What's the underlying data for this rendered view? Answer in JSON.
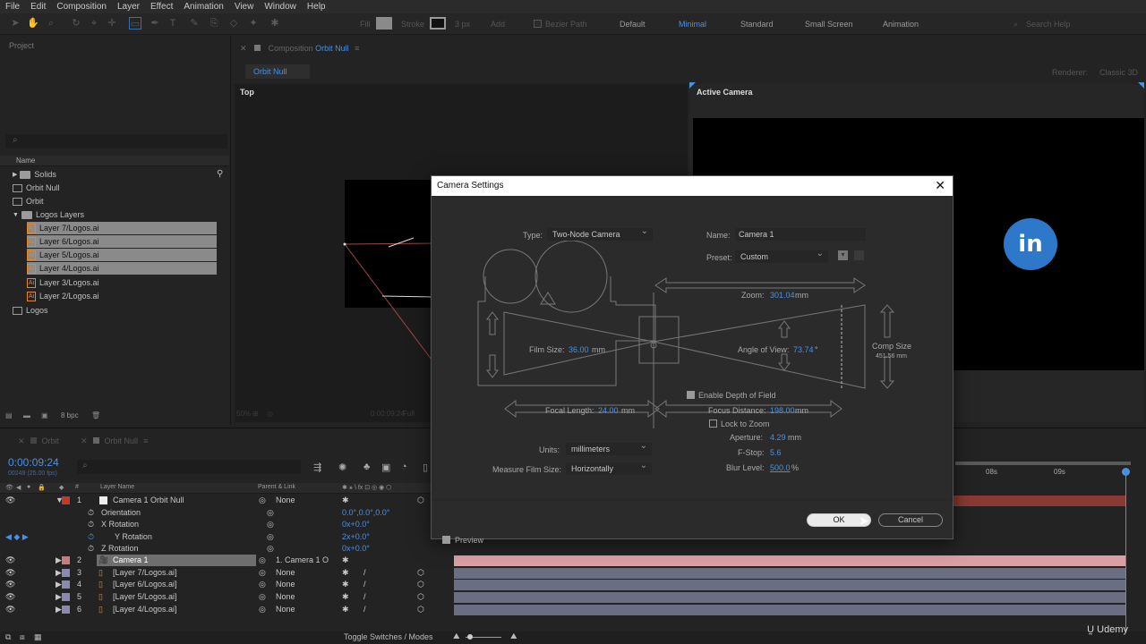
{
  "menu": [
    "File",
    "Edit",
    "Composition",
    "Layer",
    "Effect",
    "Animation",
    "View",
    "Window",
    "Help"
  ],
  "toolbar": {
    "fill": "Fill",
    "stroke": "Stroke",
    "stroke_px": "3 px",
    "add": "Add",
    "bezier": "Bezier Path",
    "workspaces": [
      "Default",
      "Minimal",
      "Standard",
      "Small Screen",
      "Animation"
    ],
    "active_workspace": "Minimal",
    "search_help": "Search Help"
  },
  "project": {
    "title": "Project",
    "col_name": "Name",
    "items": [
      {
        "label": "Solids",
        "type": "folder"
      },
      {
        "label": "Orbit Null",
        "type": "solid"
      },
      {
        "label": "Orbit",
        "type": "solid"
      },
      {
        "label": "Logos Layers",
        "type": "folder"
      },
      {
        "label": "Layer 7/Logos.ai",
        "type": "ai",
        "selected": true
      },
      {
        "label": "Layer 6/Logos.ai",
        "type": "ai",
        "selected": true
      },
      {
        "label": "Layer 5/Logos.ai",
        "type": "ai",
        "selected": true
      },
      {
        "label": "Layer 4/Logos.ai",
        "type": "ai",
        "selected": true
      },
      {
        "label": "Layer 3/Logos.ai",
        "type": "ai",
        "selected": false
      },
      {
        "label": "Layer 2/Logos.ai",
        "type": "ai",
        "selected": false
      },
      {
        "label": "Logos",
        "type": "solid"
      }
    ],
    "bpc": "8 bpc"
  },
  "comp": {
    "panel_title": "Composition",
    "comp_name": "Orbit Null",
    "tab": "Orbit Null",
    "renderer": "Renderer:",
    "renderer_value": "Classic 3D",
    "view_top": "Top",
    "view_active": "Active Camera",
    "zoom": "50%",
    "timecode": "0:00:09:24",
    "quality": "Full"
  },
  "timeline": {
    "tabs": [
      "Orbit",
      "Orbit Null"
    ],
    "timecode": "0:00:09:24",
    "fps": "00249 (25.00 fps)",
    "search_placeholder": "",
    "col_layer_name": "Layer Name",
    "col_parent": "Parent & Link",
    "ruler": [
      "08s",
      "09s"
    ],
    "rows": [
      {
        "num": "1",
        "name": "Camera 1 Orbit Null",
        "parent": "None",
        "kind": "layer",
        "color": "#c0392b"
      },
      {
        "num": "",
        "name": "Orientation",
        "value": "0.0°,0.0°,0.0°",
        "kind": "prop"
      },
      {
        "num": "",
        "name": "X Rotation",
        "value": "0x+0.0°",
        "kind": "prop"
      },
      {
        "num": "",
        "name": "Y Rotation",
        "value": "2x+0.0°",
        "kind": "prop"
      },
      {
        "num": "",
        "name": "Z Rotation",
        "value": "0x+0.0°",
        "kind": "prop"
      },
      {
        "num": "2",
        "name": "Camera 1",
        "parent": "1. Camera 1 O",
        "kind": "layer",
        "selected": true,
        "color": "#c08080"
      },
      {
        "num": "3",
        "name": "[Layer 7/Logos.ai]",
        "parent": "None",
        "kind": "layer",
        "color": "#8a8ab0"
      },
      {
        "num": "4",
        "name": "[Layer 6/Logos.ai]",
        "parent": "None",
        "kind": "layer",
        "color": "#8a8ab0"
      },
      {
        "num": "5",
        "name": "[Layer 5/Logos.ai]",
        "parent": "None",
        "kind": "layer",
        "color": "#8a8ab0"
      },
      {
        "num": "6",
        "name": "[Layer 4/Logos.ai]",
        "parent": "None",
        "kind": "layer",
        "color": "#8a8ab0"
      }
    ],
    "toggle_label": "Toggle Switches / Modes"
  },
  "dialog": {
    "title": "Camera Settings",
    "type_label": "Type:",
    "type_value": "Two-Node Camera",
    "name_label": "Name:",
    "name_value": "Camera 1",
    "preset_label": "Preset:",
    "preset_value": "Custom",
    "zoom_label": "Zoom:",
    "zoom_value": "301.04",
    "zoom_unit": "mm",
    "film_size_label": "Film Size:",
    "film_size_value": "36.00",
    "film_size_unit": "mm",
    "aov_label": "Angle of View:",
    "aov_value": "73.74",
    "aov_unit": "°",
    "comp_size_label": "Comp Size",
    "comp_size_value": "451.56 mm",
    "dof_label": "Enable Depth of Field",
    "dof_checked": true,
    "focal_length_label": "Focal Length:",
    "focal_length_value": "24.00",
    "focal_length_unit": "mm",
    "focus_distance_label": "Focus Distance:",
    "focus_distance_value": "198.00",
    "focus_distance_unit": "mm",
    "lock_zoom_label": "Lock to Zoom",
    "lock_zoom_checked": false,
    "aperture_label": "Aperture:",
    "aperture_value": "4.29",
    "aperture_unit": "mm",
    "fstop_label": "F-Stop:",
    "fstop_value": "5.6",
    "blur_label": "Blur Level:",
    "blur_value": "500.0",
    "blur_unit": "%",
    "units_label": "Units:",
    "units_value": "millimeters",
    "measure_label": "Measure Film Size:",
    "measure_value": "Horizontally",
    "preview_label": "Preview",
    "preview_checked": true,
    "ok_label": "OK",
    "cancel_label": "Cancel"
  },
  "watermark": "Udemy"
}
